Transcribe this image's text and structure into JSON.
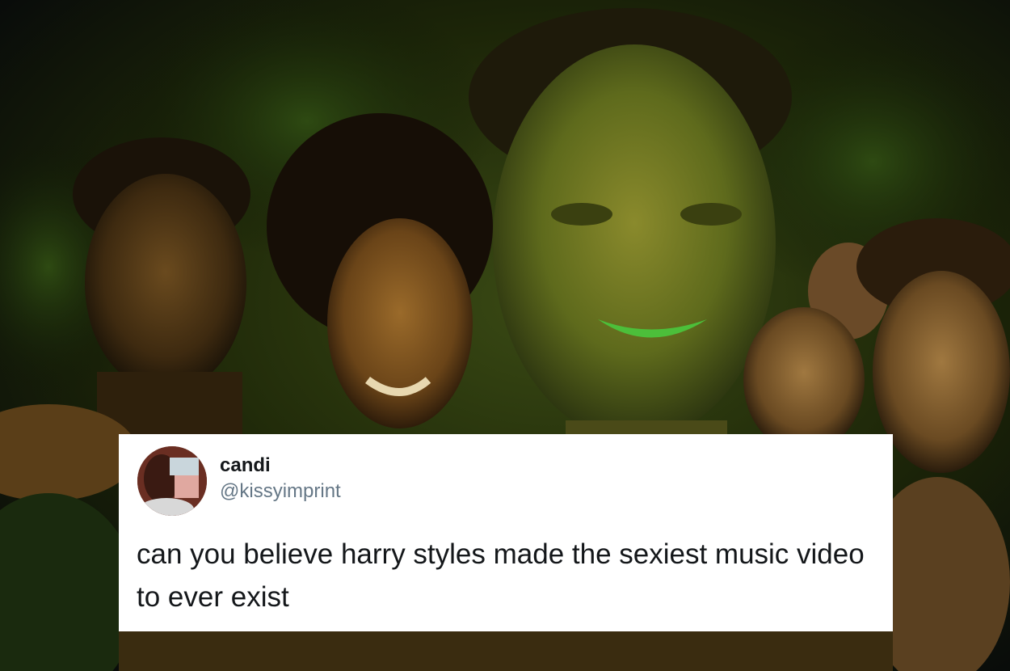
{
  "tweet": {
    "user_name": "candi",
    "user_handle": "@kissyimprint",
    "text": "can you believe harry styles made the sexiest music video to ever exist"
  },
  "colors": {
    "card_background": "#ffffff",
    "name_text": "#14171a",
    "handle_text": "#657786",
    "scene_tint": "#2a3a10"
  },
  "icons": {
    "avatar": "user-avatar-photo"
  }
}
